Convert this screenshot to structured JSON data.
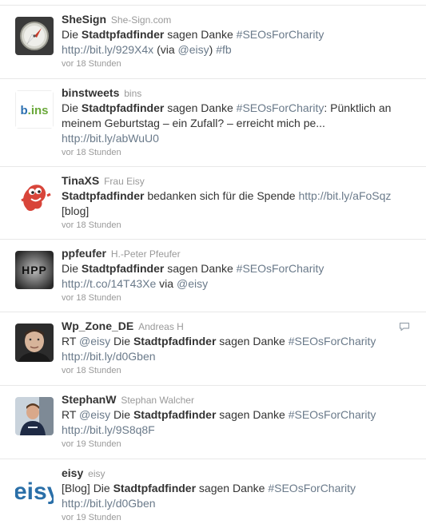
{
  "tweets": [
    {
      "screen_name": "SheSign",
      "full_name": "She-Sign.com",
      "avatar_icon": "compass-icon",
      "segments": [
        {
          "t": "Die ",
          "s": "n"
        },
        {
          "t": "Stadtpfadfinder",
          "s": "b"
        },
        {
          "t": " sagen Danke ",
          "s": "n"
        },
        {
          "t": "#SEOsForCharity",
          "s": "l"
        },
        {
          "t": " ",
          "s": "n"
        },
        {
          "t": "http://bit.ly/929X4x",
          "s": "l"
        },
        {
          "t": " (via ",
          "s": "n"
        },
        {
          "t": "@eisy",
          "s": "l"
        },
        {
          "t": ") ",
          "s": "n"
        },
        {
          "t": "#fb",
          "s": "l"
        }
      ],
      "time": "vor 18 Stunden"
    },
    {
      "screen_name": "binstweets",
      "full_name": "bins",
      "avatar_icon": "bins-logo",
      "avatar_text": "b.ins",
      "segments": [
        {
          "t": "Die ",
          "s": "n"
        },
        {
          "t": "Stadtpfadfinder",
          "s": "b"
        },
        {
          "t": " sagen Danke ",
          "s": "n"
        },
        {
          "t": "#SEOsForCharity",
          "s": "l"
        },
        {
          "t": ": Pünktlich an meinem Geburtstag – ein Zufall? – erreicht mich pe... ",
          "s": "n"
        },
        {
          "t": "http://bit.ly/abWuU0",
          "s": "l"
        }
      ],
      "time": "vor 18 Stunden"
    },
    {
      "screen_name": "TinaXS",
      "full_name": "Frau Eisy",
      "avatar_icon": "red-monster-icon",
      "segments": [
        {
          "t": "Stadtpfadfinder",
          "s": "b"
        },
        {
          "t": " bedanken sich für die Spende ",
          "s": "n"
        },
        {
          "t": "http://bit.ly/aFoSqz",
          "s": "l"
        },
        {
          "t": " [blog]",
          "s": "n"
        }
      ],
      "time": "vor 18 Stunden"
    },
    {
      "screen_name": "ppfeufer",
      "full_name": "H.-Peter Pfeufer",
      "avatar_icon": "hpp-logo",
      "avatar_text": "HPP",
      "segments": [
        {
          "t": "Die ",
          "s": "n"
        },
        {
          "t": "Stadtpfadfinder",
          "s": "b"
        },
        {
          "t": " sagen Danke ",
          "s": "n"
        },
        {
          "t": "#SEOsForCharity",
          "s": "l"
        },
        {
          "t": " ",
          "s": "n"
        },
        {
          "t": "http://t.co/14T43Xe",
          "s": "l"
        },
        {
          "t": " via ",
          "s": "n"
        },
        {
          "t": "@eisy",
          "s": "l"
        }
      ],
      "time": "vor 18 Stunden"
    },
    {
      "screen_name": "Wp_Zone_DE",
      "full_name": "Andreas H",
      "avatar_icon": "person-photo",
      "show_reply": true,
      "segments": [
        {
          "t": "RT ",
          "s": "n"
        },
        {
          "t": "@eisy",
          "s": "l"
        },
        {
          "t": " Die ",
          "s": "n"
        },
        {
          "t": "Stadtpfadfinder",
          "s": "b"
        },
        {
          "t": " sagen Danke ",
          "s": "n"
        },
        {
          "t": "#SEOsForCharity",
          "s": "l"
        },
        {
          "t": " ",
          "s": "n"
        },
        {
          "t": "http://bit.ly/d0Gben",
          "s": "l"
        }
      ],
      "time": "vor 18 Stunden"
    },
    {
      "screen_name": "StephanW",
      "full_name": "Stephan Walcher",
      "avatar_icon": "person-photo",
      "segments": [
        {
          "t": "RT ",
          "s": "n"
        },
        {
          "t": "@eisy",
          "s": "l"
        },
        {
          "t": " Die ",
          "s": "n"
        },
        {
          "t": "Stadtpfadfinder",
          "s": "b"
        },
        {
          "t": " sagen Danke ",
          "s": "n"
        },
        {
          "t": "#SEOsForCharity",
          "s": "l"
        },
        {
          "t": " ",
          "s": "n"
        },
        {
          "t": "http://bit.ly/9S8q8F",
          "s": "l"
        }
      ],
      "time": "vor 19 Stunden"
    },
    {
      "screen_name": "eisy",
      "full_name": "eisy",
      "avatar_icon": "eisy-logo",
      "avatar_text": "eisy",
      "segments": [
        {
          "t": "[Blog] Die ",
          "s": "n"
        },
        {
          "t": "Stadtpfadfinder",
          "s": "b"
        },
        {
          "t": " sagen Danke ",
          "s": "n"
        },
        {
          "t": "#SEOsForCharity",
          "s": "l"
        },
        {
          "t": " ",
          "s": "n"
        },
        {
          "t": "http://bit.ly/d0Gben",
          "s": "l"
        }
      ],
      "time": "vor 19 Stunden"
    }
  ],
  "colors": {
    "link": "#6a7a8a",
    "meta": "#999999",
    "text": "#333333",
    "divider": "#e8e8e8"
  }
}
